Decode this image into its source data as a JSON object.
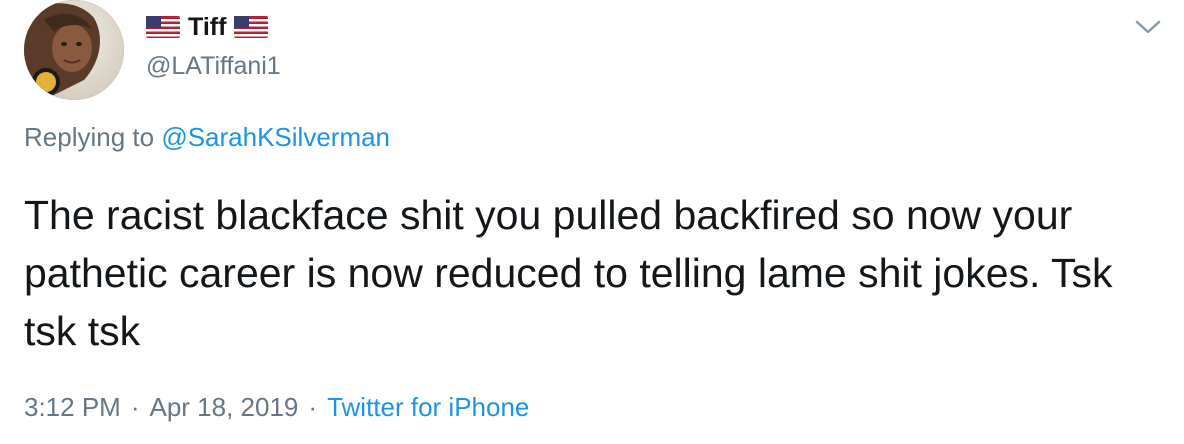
{
  "user": {
    "display_name": "Tiff",
    "handle": "@LATiffani1",
    "avatar_icon": "profile-photo",
    "name_emoji": "us-flag-icon"
  },
  "reply": {
    "prefix": "Replying to",
    "to_handle": "@SarahKSilverman"
  },
  "tweet": {
    "text": "The racist blackface shit you pulled backfired so now your pathetic career is now reduced to telling lame shit jokes. Tsk tsk tsk"
  },
  "meta": {
    "time": "3:12 PM",
    "separator1": "·",
    "date": "Apr 18, 2019",
    "separator2": "·",
    "source": "Twitter for iPhone"
  },
  "colors": {
    "text": "#14171a",
    "muted": "#657786",
    "link": "#1b95e0"
  }
}
